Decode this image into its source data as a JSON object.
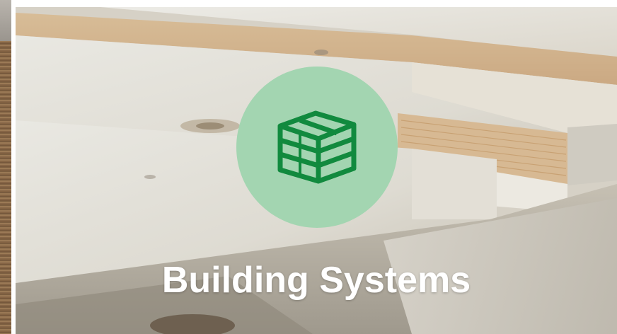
{
  "card": {
    "title": "Building Systems",
    "icon": "stacked-panels-icon"
  },
  "colors": {
    "badge_background": "#a3d5b1",
    "icon_color": "#118a3e",
    "title_color": "#ffffff"
  }
}
